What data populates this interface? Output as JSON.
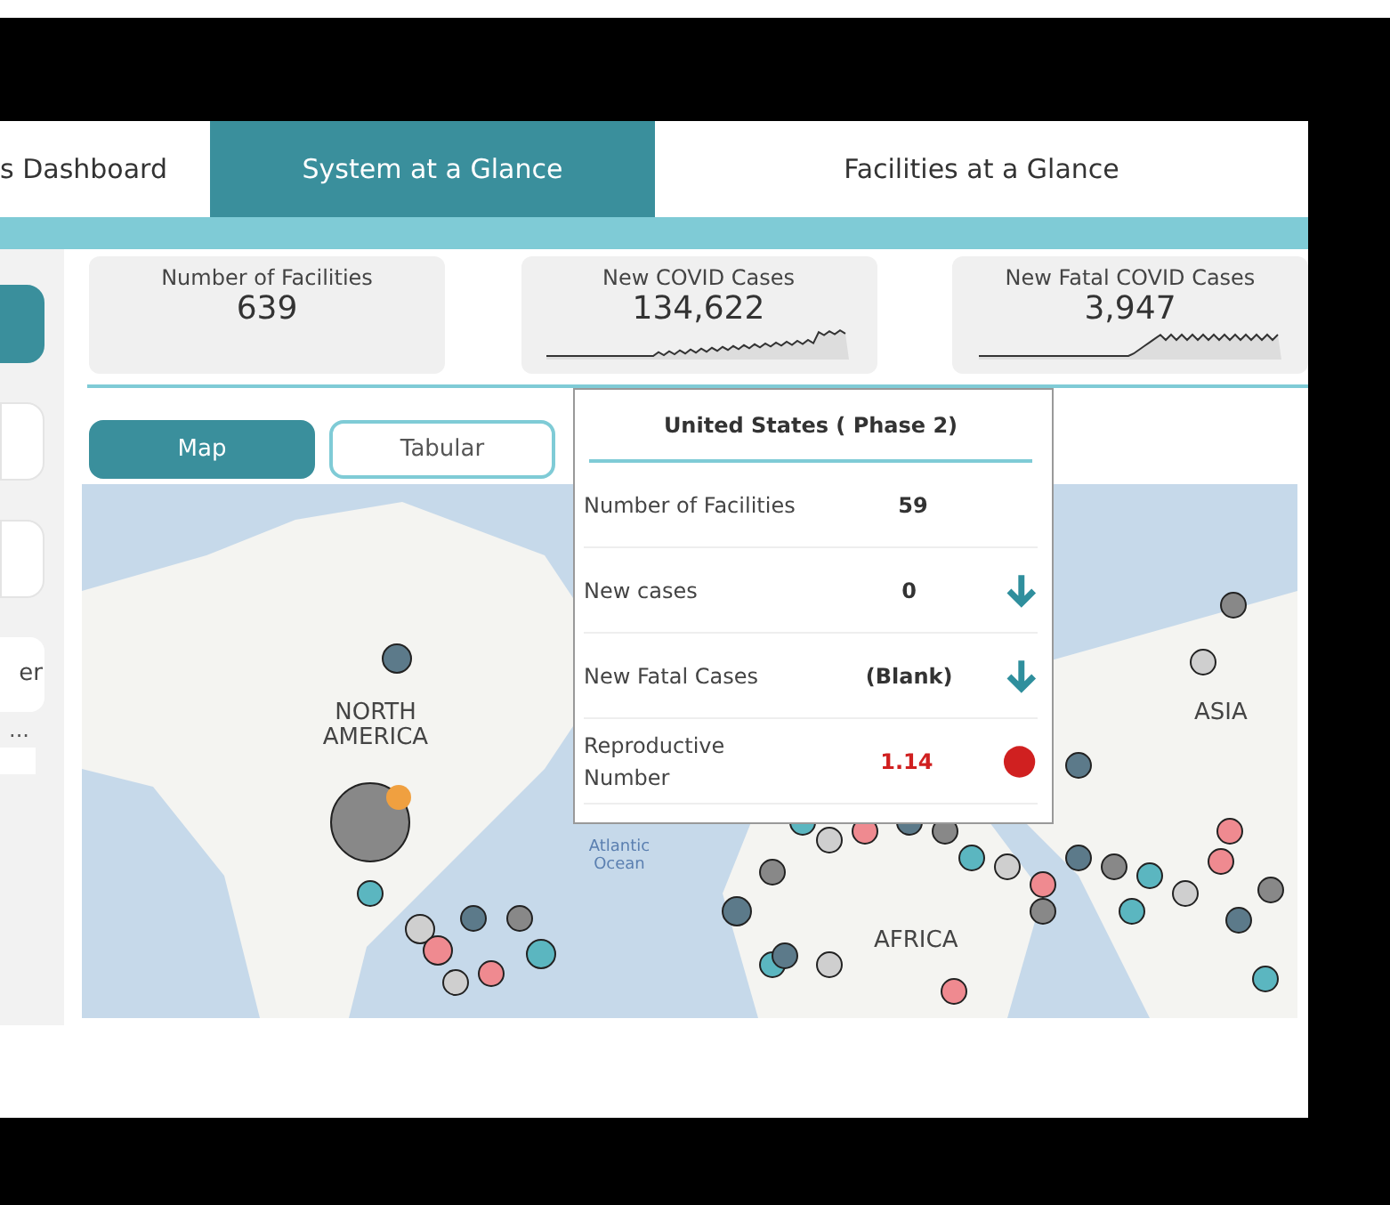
{
  "tabs": [
    {
      "label": "s Dashboard",
      "selected": false
    },
    {
      "label": "System at a Glance",
      "selected": true
    },
    {
      "label": "Facilities at a Glance",
      "selected": false
    }
  ],
  "sidebar": {
    "buttons": [
      {
        "selected": true
      },
      {
        "selected": false
      },
      {
        "selected": false
      }
    ],
    "slicer_label": "er",
    "more": "..."
  },
  "kpis": [
    {
      "title": "Number of Facilities",
      "value": "639",
      "kind": "number"
    },
    {
      "title": "New COVID Cases",
      "value": "134,622",
      "kind": "sparkline"
    },
    {
      "title": "New Fatal COVID Cases",
      "value": "3,947",
      "kind": "sparkline"
    }
  ],
  "view_toggle": [
    {
      "label": "Map",
      "selected": true
    },
    {
      "label": "Tabular",
      "selected": false
    }
  ],
  "map": {
    "labels": [
      {
        "text": "NORTH AMERICA",
        "kind": "continent"
      },
      {
        "text": "ASIA",
        "kind": "continent"
      },
      {
        "text": "Atlantic Ocean",
        "kind": "ocean"
      },
      {
        "text": "AFRICA",
        "kind": "continent"
      }
    ]
  },
  "tooltip": {
    "title": "United States  ( Phase 2)",
    "rows": [
      {
        "label": "Number of Facilities",
        "value": "59",
        "kind": "plain",
        "highlight": false
      },
      {
        "label": "New cases",
        "value": "0",
        "kind": "trend",
        "highlight": false
      },
      {
        "label": "New Fatal Cases",
        "value": "(Blank)",
        "kind": "trend",
        "highlight": false
      },
      {
        "label": "Reproductive Number",
        "value": "1.14",
        "kind": "status",
        "highlight": true
      }
    ]
  }
}
